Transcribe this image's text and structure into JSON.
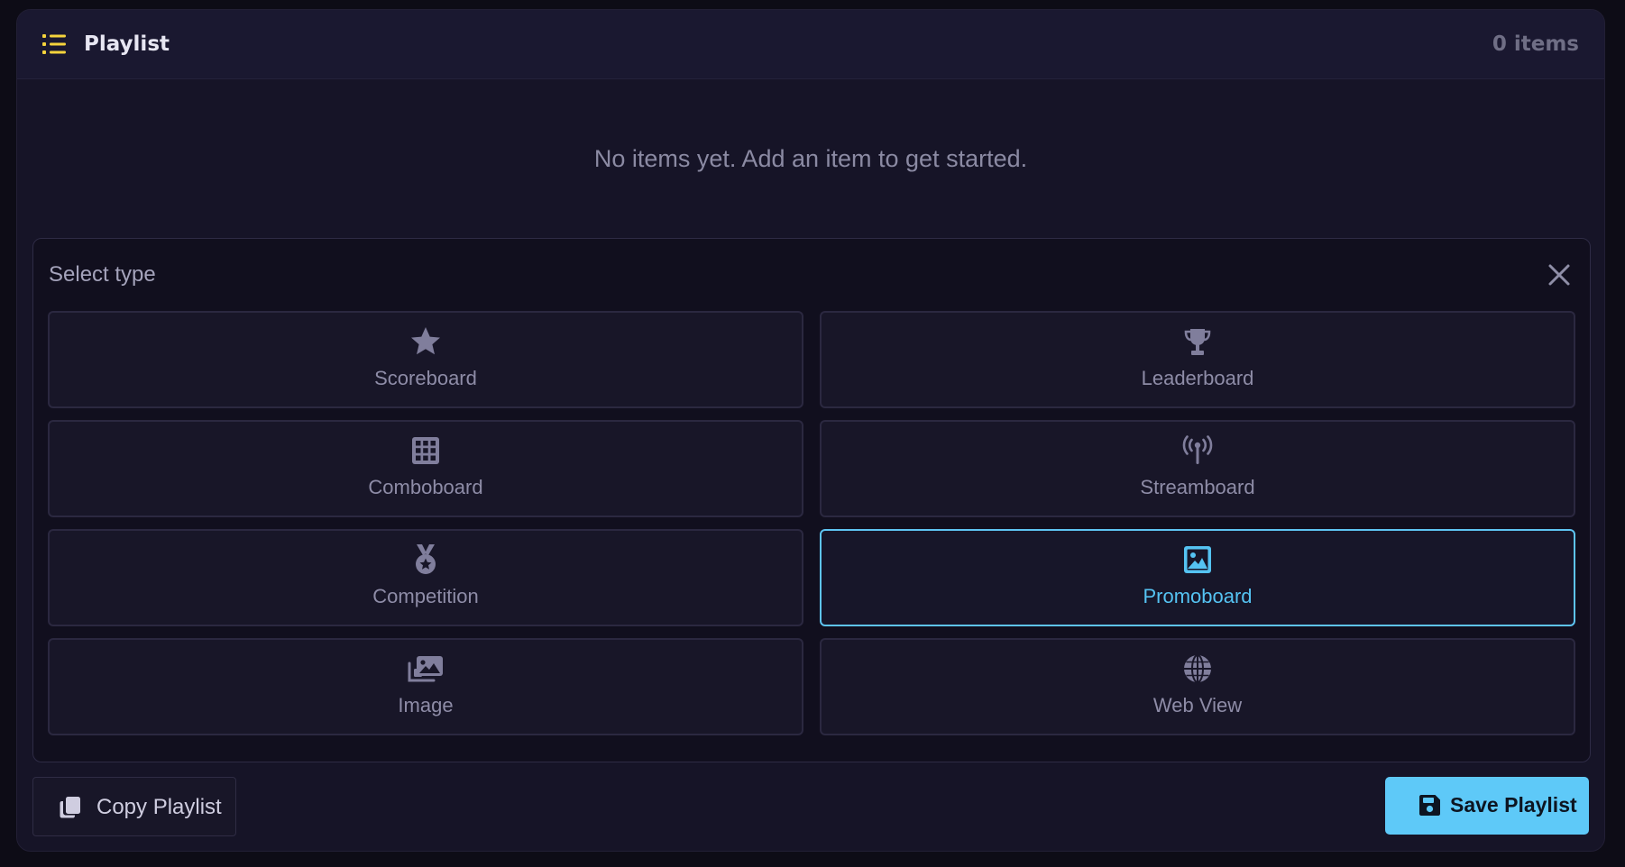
{
  "header": {
    "icon": "list-icon",
    "title": "Playlist",
    "count": "0 items"
  },
  "empty_message": "No items yet. Add an item to get started.",
  "selector": {
    "title": "Select type",
    "close_icon": "close-icon",
    "types": [
      {
        "label": "Scoreboard",
        "icon": "star-icon",
        "selected": false
      },
      {
        "label": "Leaderboard",
        "icon": "trophy-icon",
        "selected": false
      },
      {
        "label": "Comboboard",
        "icon": "grid-icon",
        "selected": false
      },
      {
        "label": "Streamboard",
        "icon": "broadcast-tower-icon",
        "selected": false
      },
      {
        "label": "Competition",
        "icon": "medal-icon",
        "selected": false
      },
      {
        "label": "Promoboard",
        "icon": "image-icon",
        "selected": true
      },
      {
        "label": "Image",
        "icon": "images-icon",
        "selected": false
      },
      {
        "label": "Web View",
        "icon": "globe-icon",
        "selected": false
      }
    ]
  },
  "footer": {
    "copy_label": "Copy Playlist",
    "copy_icon": "copy-icon",
    "save_label": "Save Playlist",
    "save_icon": "floppy-disk-icon"
  },
  "colors": {
    "accent": "#5ec9f8",
    "header_icon": "#f5d33c",
    "background": "#161427"
  }
}
